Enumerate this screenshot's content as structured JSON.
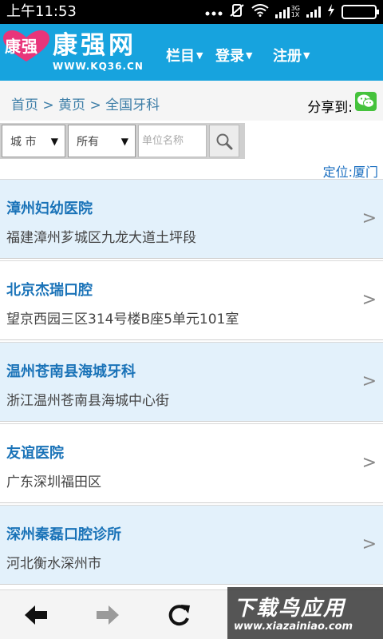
{
  "status_bar": {
    "time": "上午11:53",
    "network_label_top": "3G",
    "network_label_bottom": "1X"
  },
  "header": {
    "logo": {
      "heart_text": "康强",
      "name": "康强网",
      "url": "WWW.KQ36.CN"
    },
    "nav": [
      {
        "label": "栏目"
      },
      {
        "label": "登录"
      },
      {
        "label": "注册"
      }
    ],
    "caret": "▼"
  },
  "breadcrumb": {
    "text": "首页 > 黄页 > 全国牙科",
    "share_label": "分享到:"
  },
  "search": {
    "city_select": "城 市",
    "type_select": "所有",
    "unit_placeholder": "单位名称",
    "locate_label": "定位:",
    "locate_city": "厦门"
  },
  "list": [
    {
      "name": "漳州妇幼医院",
      "address": "福建漳州芗城区九龙大道土坪段"
    },
    {
      "name": "北京杰瑞口腔",
      "address": "望京西园三区314号楼B座5单元101室"
    },
    {
      "name": "温州苍南县海城牙科",
      "address": "浙江温州苍南县海城中心街"
    },
    {
      "name": "友谊医院",
      "address": "广东深圳福田区"
    },
    {
      "name": "深州秦磊口腔诊所",
      "address": "河北衡水深州市"
    }
  ],
  "arrow": ">",
  "watermark": {
    "title": "下载鸟应用",
    "url": "www.xiazainiao.com"
  },
  "colors": {
    "header_bg": "#17a3de",
    "link_blue": "#1a73b8",
    "row_blue": "#e3f1fb",
    "wechat_green": "#45c23c"
  }
}
